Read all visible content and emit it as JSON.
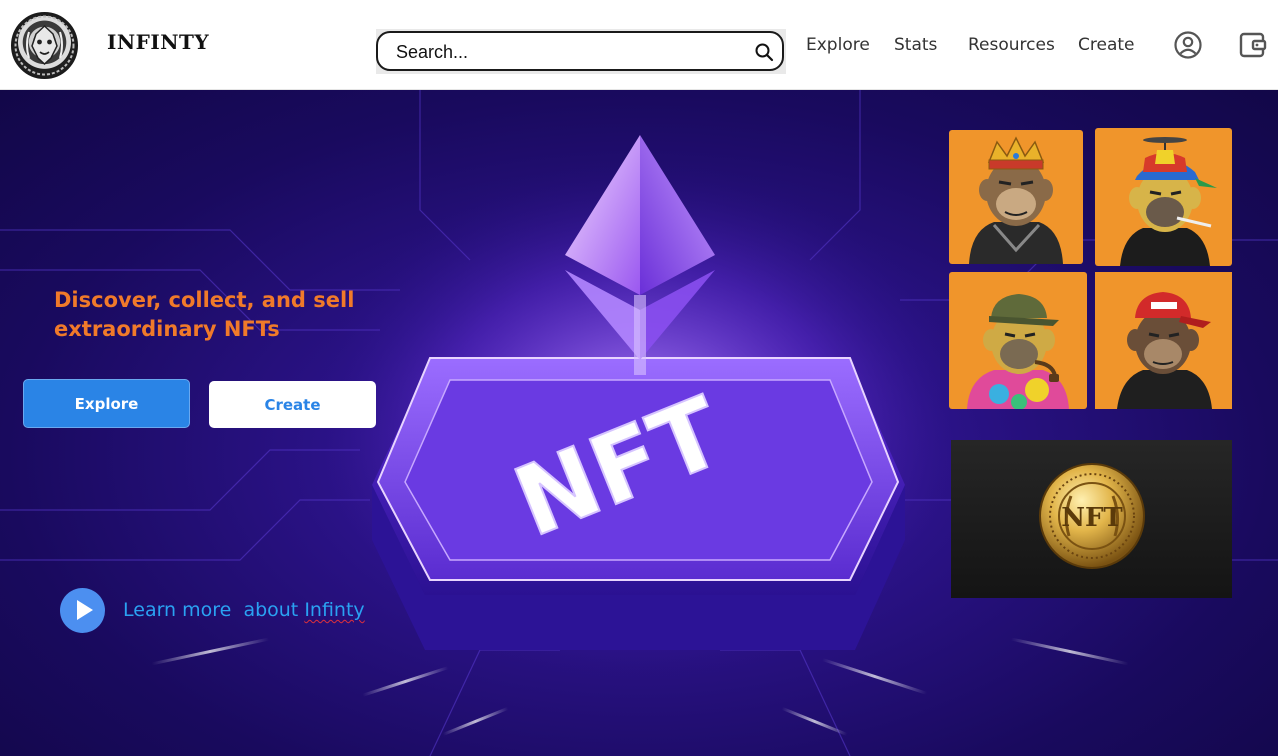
{
  "brand": {
    "name": "INFINTY",
    "logo_icon": "lion-crest-logo-icon"
  },
  "search": {
    "placeholder": "Search...",
    "icon": "search-icon"
  },
  "nav": {
    "items": [
      "Explore",
      "Stats",
      "Resources",
      "Create"
    ],
    "profile_icon": "account-circle-icon",
    "wallet_icon": "wallet-icon"
  },
  "hero": {
    "headline_line1": "Discover, collect, and sell",
    "headline_line2": "extraordinary NFTs",
    "explore_label": "Explore",
    "create_label": "Create",
    "learn_more_prefix": "Learn more  about ",
    "learn_more_brand": "Infinty",
    "play_icon": "play-icon",
    "center_graphic_text": "NFT",
    "coin_text": "NFT"
  },
  "nft_tiles": [
    {
      "name": "ape-crown",
      "hat": "crown"
    },
    {
      "name": "ape-propeller-cap",
      "hat": "propeller cap"
    },
    {
      "name": "ape-army-cap",
      "hat": "army cap"
    },
    {
      "name": "ape-red-cap",
      "hat": "red cap"
    }
  ],
  "colors": {
    "accent_orange": "#f07a2a",
    "explore_blue": "#2a84e6",
    "link_blue": "#2aa2f2",
    "hero_purple": "#2a1286",
    "tile_orange": "#f0952b",
    "coin_gold": "#d9a83a"
  }
}
